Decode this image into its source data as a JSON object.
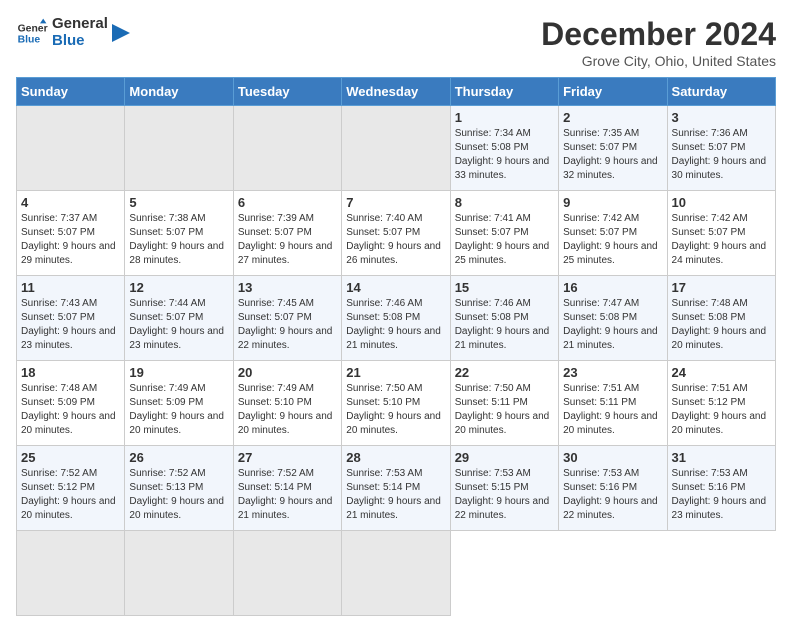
{
  "logo": {
    "line1": "General",
    "line2": "Blue"
  },
  "title": "December 2024",
  "location": "Grove City, Ohio, United States",
  "weekdays": [
    "Sunday",
    "Monday",
    "Tuesday",
    "Wednesday",
    "Thursday",
    "Friday",
    "Saturday"
  ],
  "days": [
    {
      "num": "",
      "empty": true
    },
    {
      "num": "",
      "empty": true
    },
    {
      "num": "",
      "empty": true
    },
    {
      "num": "",
      "empty": true
    },
    {
      "num": "1",
      "sunrise": "7:34 AM",
      "sunset": "5:08 PM",
      "daylight": "9 hours and 33 minutes."
    },
    {
      "num": "2",
      "sunrise": "7:35 AM",
      "sunset": "5:07 PM",
      "daylight": "9 hours and 32 minutes."
    },
    {
      "num": "3",
      "sunrise": "7:36 AM",
      "sunset": "5:07 PM",
      "daylight": "9 hours and 30 minutes."
    },
    {
      "num": "4",
      "sunrise": "7:37 AM",
      "sunset": "5:07 PM",
      "daylight": "9 hours and 29 minutes."
    },
    {
      "num": "5",
      "sunrise": "7:38 AM",
      "sunset": "5:07 PM",
      "daylight": "9 hours and 28 minutes."
    },
    {
      "num": "6",
      "sunrise": "7:39 AM",
      "sunset": "5:07 PM",
      "daylight": "9 hours and 27 minutes."
    },
    {
      "num": "7",
      "sunrise": "7:40 AM",
      "sunset": "5:07 PM",
      "daylight": "9 hours and 26 minutes."
    },
    {
      "num": "8",
      "sunrise": "7:41 AM",
      "sunset": "5:07 PM",
      "daylight": "9 hours and 25 minutes."
    },
    {
      "num": "9",
      "sunrise": "7:42 AM",
      "sunset": "5:07 PM",
      "daylight": "9 hours and 25 minutes."
    },
    {
      "num": "10",
      "sunrise": "7:42 AM",
      "sunset": "5:07 PM",
      "daylight": "9 hours and 24 minutes."
    },
    {
      "num": "11",
      "sunrise": "7:43 AM",
      "sunset": "5:07 PM",
      "daylight": "9 hours and 23 minutes."
    },
    {
      "num": "12",
      "sunrise": "7:44 AM",
      "sunset": "5:07 PM",
      "daylight": "9 hours and 23 minutes."
    },
    {
      "num": "13",
      "sunrise": "7:45 AM",
      "sunset": "5:07 PM",
      "daylight": "9 hours and 22 minutes."
    },
    {
      "num": "14",
      "sunrise": "7:46 AM",
      "sunset": "5:08 PM",
      "daylight": "9 hours and 21 minutes."
    },
    {
      "num": "15",
      "sunrise": "7:46 AM",
      "sunset": "5:08 PM",
      "daylight": "9 hours and 21 minutes."
    },
    {
      "num": "16",
      "sunrise": "7:47 AM",
      "sunset": "5:08 PM",
      "daylight": "9 hours and 21 minutes."
    },
    {
      "num": "17",
      "sunrise": "7:48 AM",
      "sunset": "5:08 PM",
      "daylight": "9 hours and 20 minutes."
    },
    {
      "num": "18",
      "sunrise": "7:48 AM",
      "sunset": "5:09 PM",
      "daylight": "9 hours and 20 minutes."
    },
    {
      "num": "19",
      "sunrise": "7:49 AM",
      "sunset": "5:09 PM",
      "daylight": "9 hours and 20 minutes."
    },
    {
      "num": "20",
      "sunrise": "7:49 AM",
      "sunset": "5:10 PM",
      "daylight": "9 hours and 20 minutes."
    },
    {
      "num": "21",
      "sunrise": "7:50 AM",
      "sunset": "5:10 PM",
      "daylight": "9 hours and 20 minutes."
    },
    {
      "num": "22",
      "sunrise": "7:50 AM",
      "sunset": "5:11 PM",
      "daylight": "9 hours and 20 minutes."
    },
    {
      "num": "23",
      "sunrise": "7:51 AM",
      "sunset": "5:11 PM",
      "daylight": "9 hours and 20 minutes."
    },
    {
      "num": "24",
      "sunrise": "7:51 AM",
      "sunset": "5:12 PM",
      "daylight": "9 hours and 20 minutes."
    },
    {
      "num": "25",
      "sunrise": "7:52 AM",
      "sunset": "5:12 PM",
      "daylight": "9 hours and 20 minutes."
    },
    {
      "num": "26",
      "sunrise": "7:52 AM",
      "sunset": "5:13 PM",
      "daylight": "9 hours and 20 minutes."
    },
    {
      "num": "27",
      "sunrise": "7:52 AM",
      "sunset": "5:14 PM",
      "daylight": "9 hours and 21 minutes."
    },
    {
      "num": "28",
      "sunrise": "7:53 AM",
      "sunset": "5:14 PM",
      "daylight": "9 hours and 21 minutes."
    },
    {
      "num": "29",
      "sunrise": "7:53 AM",
      "sunset": "5:15 PM",
      "daylight": "9 hours and 22 minutes."
    },
    {
      "num": "30",
      "sunrise": "7:53 AM",
      "sunset": "5:16 PM",
      "daylight": "9 hours and 22 minutes."
    },
    {
      "num": "31",
      "sunrise": "7:53 AM",
      "sunset": "5:16 PM",
      "daylight": "9 hours and 23 minutes."
    },
    {
      "num": "",
      "empty": true
    },
    {
      "num": "",
      "empty": true
    },
    {
      "num": "",
      "empty": true
    },
    {
      "num": "",
      "empty": true
    }
  ],
  "labels": {
    "sunrise": "Sunrise:",
    "sunset": "Sunset:",
    "daylight": "Daylight:"
  }
}
